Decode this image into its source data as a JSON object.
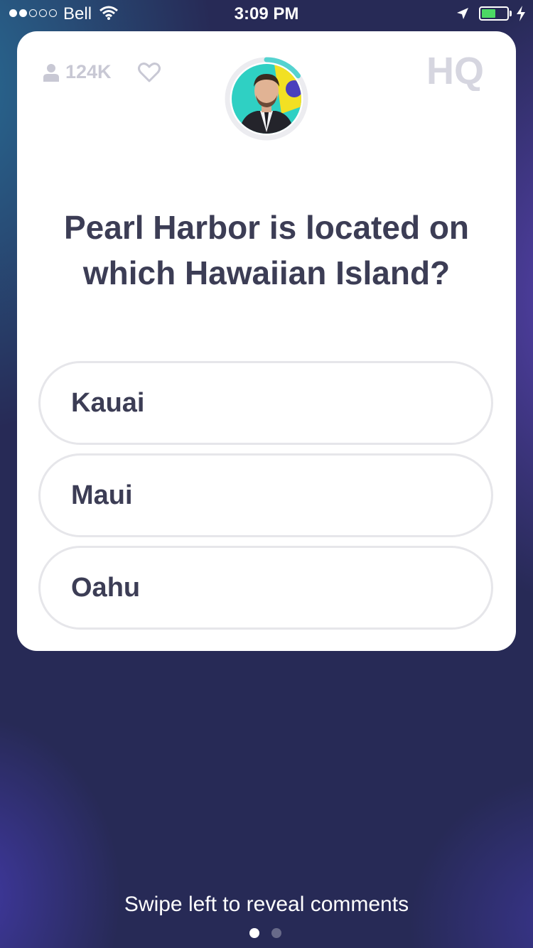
{
  "status_bar": {
    "carrier": "Bell",
    "time": "3:09 PM",
    "battery_level": 0.55,
    "signal_bars_filled": 2,
    "signal_bars_total": 5
  },
  "card": {
    "viewer_count": "124K",
    "logo_text": "HQ",
    "question": "Pearl Harbor is located on which Hawaiian Island?",
    "answers": [
      {
        "label": "Kauai"
      },
      {
        "label": "Maui"
      },
      {
        "label": "Oahu"
      }
    ],
    "timer_progress": 0.15
  },
  "footer": {
    "hint": "Swipe left to reveal comments",
    "pages": 2,
    "active_page": 1
  },
  "colors": {
    "question_text": "#3c3d55",
    "muted": "#c8c8d4",
    "timer": "#55d3d0",
    "battery": "#4cd964",
    "background": "#272a56"
  },
  "icons": [
    "wifi-icon",
    "location-arrow-icon",
    "battery-icon",
    "charging-bolt-icon",
    "person-icon",
    "heart-icon",
    "hq-logo-icon"
  ]
}
